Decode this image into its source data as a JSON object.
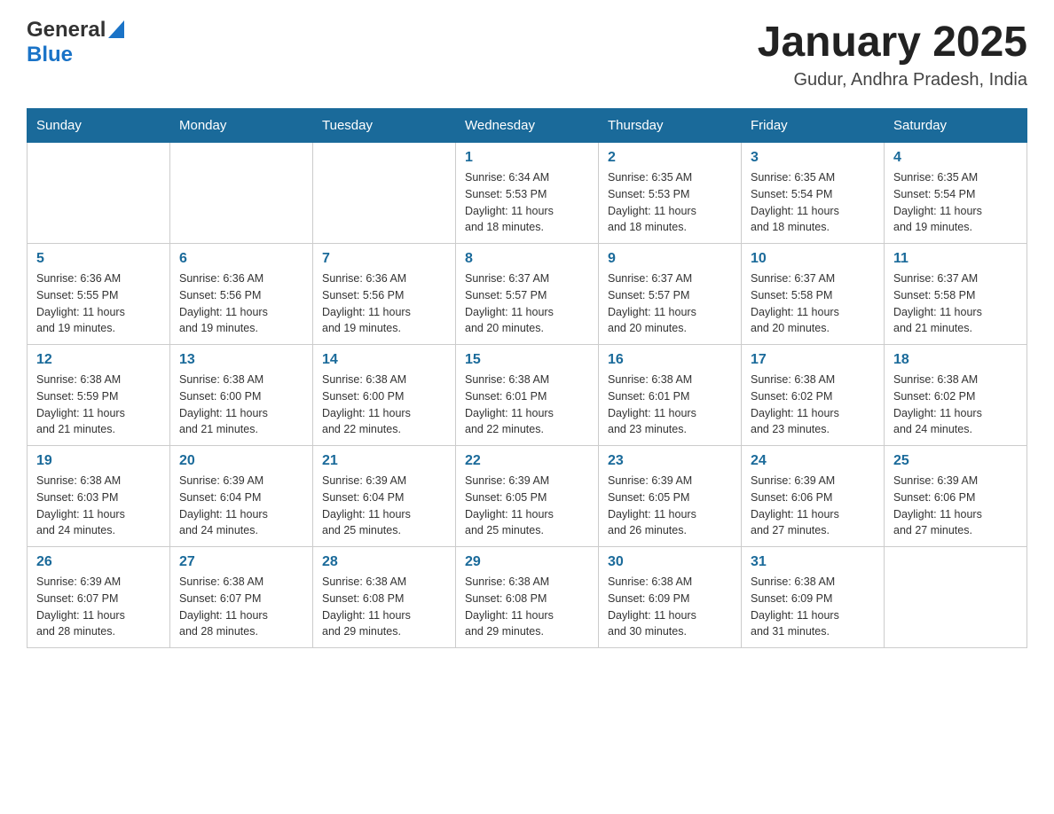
{
  "header": {
    "logo_general": "General",
    "logo_blue": "Blue",
    "month_title": "January 2025",
    "location": "Gudur, Andhra Pradesh, India"
  },
  "weekdays": [
    "Sunday",
    "Monday",
    "Tuesday",
    "Wednesday",
    "Thursday",
    "Friday",
    "Saturday"
  ],
  "weeks": [
    [
      {
        "day": "",
        "info": ""
      },
      {
        "day": "",
        "info": ""
      },
      {
        "day": "",
        "info": ""
      },
      {
        "day": "1",
        "info": "Sunrise: 6:34 AM\nSunset: 5:53 PM\nDaylight: 11 hours\nand 18 minutes."
      },
      {
        "day": "2",
        "info": "Sunrise: 6:35 AM\nSunset: 5:53 PM\nDaylight: 11 hours\nand 18 minutes."
      },
      {
        "day": "3",
        "info": "Sunrise: 6:35 AM\nSunset: 5:54 PM\nDaylight: 11 hours\nand 18 minutes."
      },
      {
        "day": "4",
        "info": "Sunrise: 6:35 AM\nSunset: 5:54 PM\nDaylight: 11 hours\nand 19 minutes."
      }
    ],
    [
      {
        "day": "5",
        "info": "Sunrise: 6:36 AM\nSunset: 5:55 PM\nDaylight: 11 hours\nand 19 minutes."
      },
      {
        "day": "6",
        "info": "Sunrise: 6:36 AM\nSunset: 5:56 PM\nDaylight: 11 hours\nand 19 minutes."
      },
      {
        "day": "7",
        "info": "Sunrise: 6:36 AM\nSunset: 5:56 PM\nDaylight: 11 hours\nand 19 minutes."
      },
      {
        "day": "8",
        "info": "Sunrise: 6:37 AM\nSunset: 5:57 PM\nDaylight: 11 hours\nand 20 minutes."
      },
      {
        "day": "9",
        "info": "Sunrise: 6:37 AM\nSunset: 5:57 PM\nDaylight: 11 hours\nand 20 minutes."
      },
      {
        "day": "10",
        "info": "Sunrise: 6:37 AM\nSunset: 5:58 PM\nDaylight: 11 hours\nand 20 minutes."
      },
      {
        "day": "11",
        "info": "Sunrise: 6:37 AM\nSunset: 5:58 PM\nDaylight: 11 hours\nand 21 minutes."
      }
    ],
    [
      {
        "day": "12",
        "info": "Sunrise: 6:38 AM\nSunset: 5:59 PM\nDaylight: 11 hours\nand 21 minutes."
      },
      {
        "day": "13",
        "info": "Sunrise: 6:38 AM\nSunset: 6:00 PM\nDaylight: 11 hours\nand 21 minutes."
      },
      {
        "day": "14",
        "info": "Sunrise: 6:38 AM\nSunset: 6:00 PM\nDaylight: 11 hours\nand 22 minutes."
      },
      {
        "day": "15",
        "info": "Sunrise: 6:38 AM\nSunset: 6:01 PM\nDaylight: 11 hours\nand 22 minutes."
      },
      {
        "day": "16",
        "info": "Sunrise: 6:38 AM\nSunset: 6:01 PM\nDaylight: 11 hours\nand 23 minutes."
      },
      {
        "day": "17",
        "info": "Sunrise: 6:38 AM\nSunset: 6:02 PM\nDaylight: 11 hours\nand 23 minutes."
      },
      {
        "day": "18",
        "info": "Sunrise: 6:38 AM\nSunset: 6:02 PM\nDaylight: 11 hours\nand 24 minutes."
      }
    ],
    [
      {
        "day": "19",
        "info": "Sunrise: 6:38 AM\nSunset: 6:03 PM\nDaylight: 11 hours\nand 24 minutes."
      },
      {
        "day": "20",
        "info": "Sunrise: 6:39 AM\nSunset: 6:04 PM\nDaylight: 11 hours\nand 24 minutes."
      },
      {
        "day": "21",
        "info": "Sunrise: 6:39 AM\nSunset: 6:04 PM\nDaylight: 11 hours\nand 25 minutes."
      },
      {
        "day": "22",
        "info": "Sunrise: 6:39 AM\nSunset: 6:05 PM\nDaylight: 11 hours\nand 25 minutes."
      },
      {
        "day": "23",
        "info": "Sunrise: 6:39 AM\nSunset: 6:05 PM\nDaylight: 11 hours\nand 26 minutes."
      },
      {
        "day": "24",
        "info": "Sunrise: 6:39 AM\nSunset: 6:06 PM\nDaylight: 11 hours\nand 27 minutes."
      },
      {
        "day": "25",
        "info": "Sunrise: 6:39 AM\nSunset: 6:06 PM\nDaylight: 11 hours\nand 27 minutes."
      }
    ],
    [
      {
        "day": "26",
        "info": "Sunrise: 6:39 AM\nSunset: 6:07 PM\nDaylight: 11 hours\nand 28 minutes."
      },
      {
        "day": "27",
        "info": "Sunrise: 6:38 AM\nSunset: 6:07 PM\nDaylight: 11 hours\nand 28 minutes."
      },
      {
        "day": "28",
        "info": "Sunrise: 6:38 AM\nSunset: 6:08 PM\nDaylight: 11 hours\nand 29 minutes."
      },
      {
        "day": "29",
        "info": "Sunrise: 6:38 AM\nSunset: 6:08 PM\nDaylight: 11 hours\nand 29 minutes."
      },
      {
        "day": "30",
        "info": "Sunrise: 6:38 AM\nSunset: 6:09 PM\nDaylight: 11 hours\nand 30 minutes."
      },
      {
        "day": "31",
        "info": "Sunrise: 6:38 AM\nSunset: 6:09 PM\nDaylight: 11 hours\nand 31 minutes."
      },
      {
        "day": "",
        "info": ""
      }
    ]
  ]
}
